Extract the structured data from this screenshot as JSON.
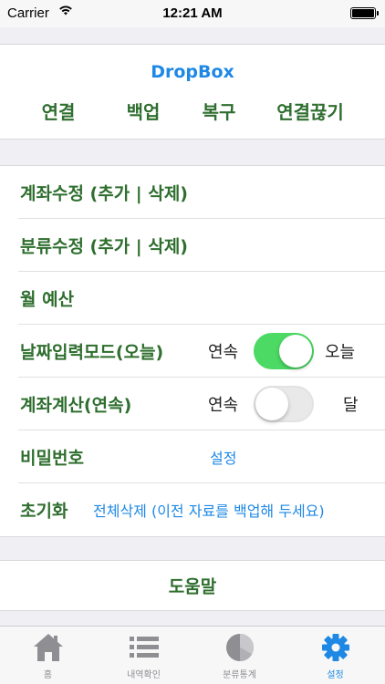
{
  "status_bar": {
    "carrier": "Carrier",
    "time": "12:21 AM",
    "battery_level": 1.0
  },
  "dropbox": {
    "title": "DropBox",
    "actions": [
      "연결",
      "백업",
      "복구",
      "연결끊기"
    ]
  },
  "settings": {
    "account_edit": "계좌수정  (추가 | 삭제)",
    "category_edit": "분류수정  (추가 | 삭제)",
    "monthly_budget": "월 예산",
    "date_input_mode": {
      "label": "날짜입력모드(오늘)",
      "left": "연속",
      "right": "오늘",
      "toggle_on": true
    },
    "account_calc": {
      "label": "계좌계산(연속)",
      "left": "연속",
      "right": "달",
      "toggle_on": false
    },
    "password": {
      "label": "비밀번호",
      "link": "설정"
    },
    "reset": {
      "label": "초기화",
      "link": "전체삭제 (이전 자료를 백업해 두세요)"
    }
  },
  "help": {
    "label": "도움말"
  },
  "tab_bar": {
    "tabs": [
      {
        "label": "홈",
        "icon": "home-icon"
      },
      {
        "label": "내역확인",
        "icon": "list-icon"
      },
      {
        "label": "분류통계",
        "icon": "pie-chart-icon"
      },
      {
        "label": "설정",
        "icon": "gear-icon"
      }
    ],
    "active_index": 3
  },
  "colors": {
    "accent_blue": "#1e88e5",
    "label_green": "#2e6e2e",
    "toggle_on": "#4cd964",
    "tab_inactive": "#8e8e93"
  }
}
